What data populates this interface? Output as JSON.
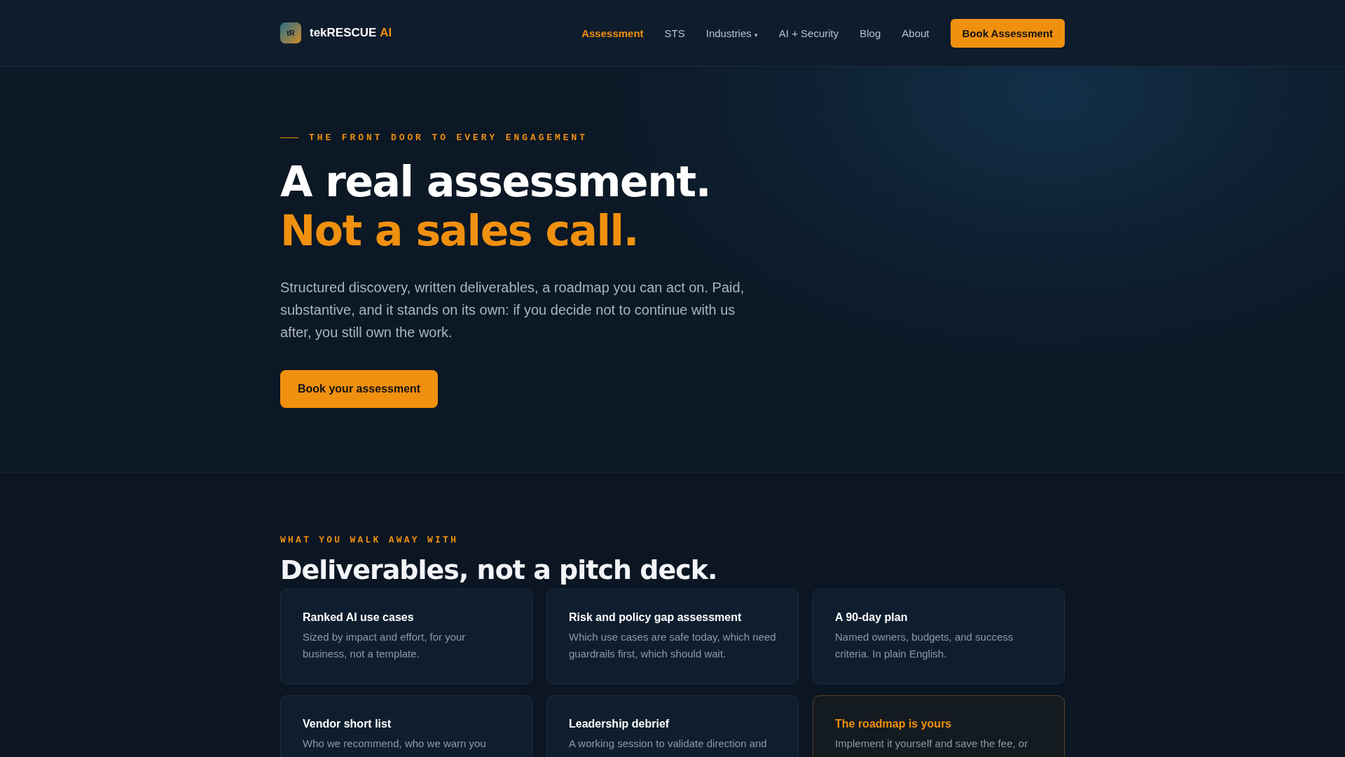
{
  "header": {
    "logo": {
      "mark": "tR",
      "name": "tekRESCUE",
      "suffix": "AI"
    },
    "nav": [
      {
        "label": "Assessment",
        "selected": true
      },
      {
        "label": "STS",
        "selected": false
      },
      {
        "label": "Industries",
        "selected": false,
        "caret": "▾"
      },
      {
        "label": "AI + Security",
        "selected": false
      },
      {
        "label": "Blog",
        "selected": false
      },
      {
        "label": "About",
        "selected": false
      }
    ],
    "cta": "Book Assessment"
  },
  "hero": {
    "eyebrow": "THE FRONT DOOR TO EVERY ENGAGEMENT",
    "title_line_1": "A real assessment.",
    "title_line_2": "Not a sales call.",
    "lead": "Structured discovery, written deliverables, a roadmap you can act on. Paid, substantive, and it stands on its own: if you decide not to continue with us after, you still own the work.",
    "button": "Book your assessment"
  },
  "deliverables": {
    "eyebrow": "WHAT YOU WALK AWAY WITH",
    "title": "Deliverables, not a pitch deck.",
    "cards": [
      {
        "title": "Ranked AI use cases",
        "text": "Sized by impact and effort, for your business, not a template.",
        "highlighted": false
      },
      {
        "title": "Risk and policy gap assessment",
        "text": "Which use cases are safe today, which need guardrails first, which should wait.",
        "highlighted": false
      },
      {
        "title": "A 90-day plan",
        "text": "Named owners, budgets, and success criteria. In plain English.",
        "highlighted": false
      },
      {
        "title": "Vendor short list",
        "text": "Who we recommend, who we warn you",
        "highlighted": false
      },
      {
        "title": "Leadership debrief",
        "text": "A working session to validate direction and",
        "highlighted": false
      },
      {
        "title": "The roadmap is yours",
        "text": "Implement it yourself and save the fee, or",
        "highlighted": true
      }
    ]
  }
}
